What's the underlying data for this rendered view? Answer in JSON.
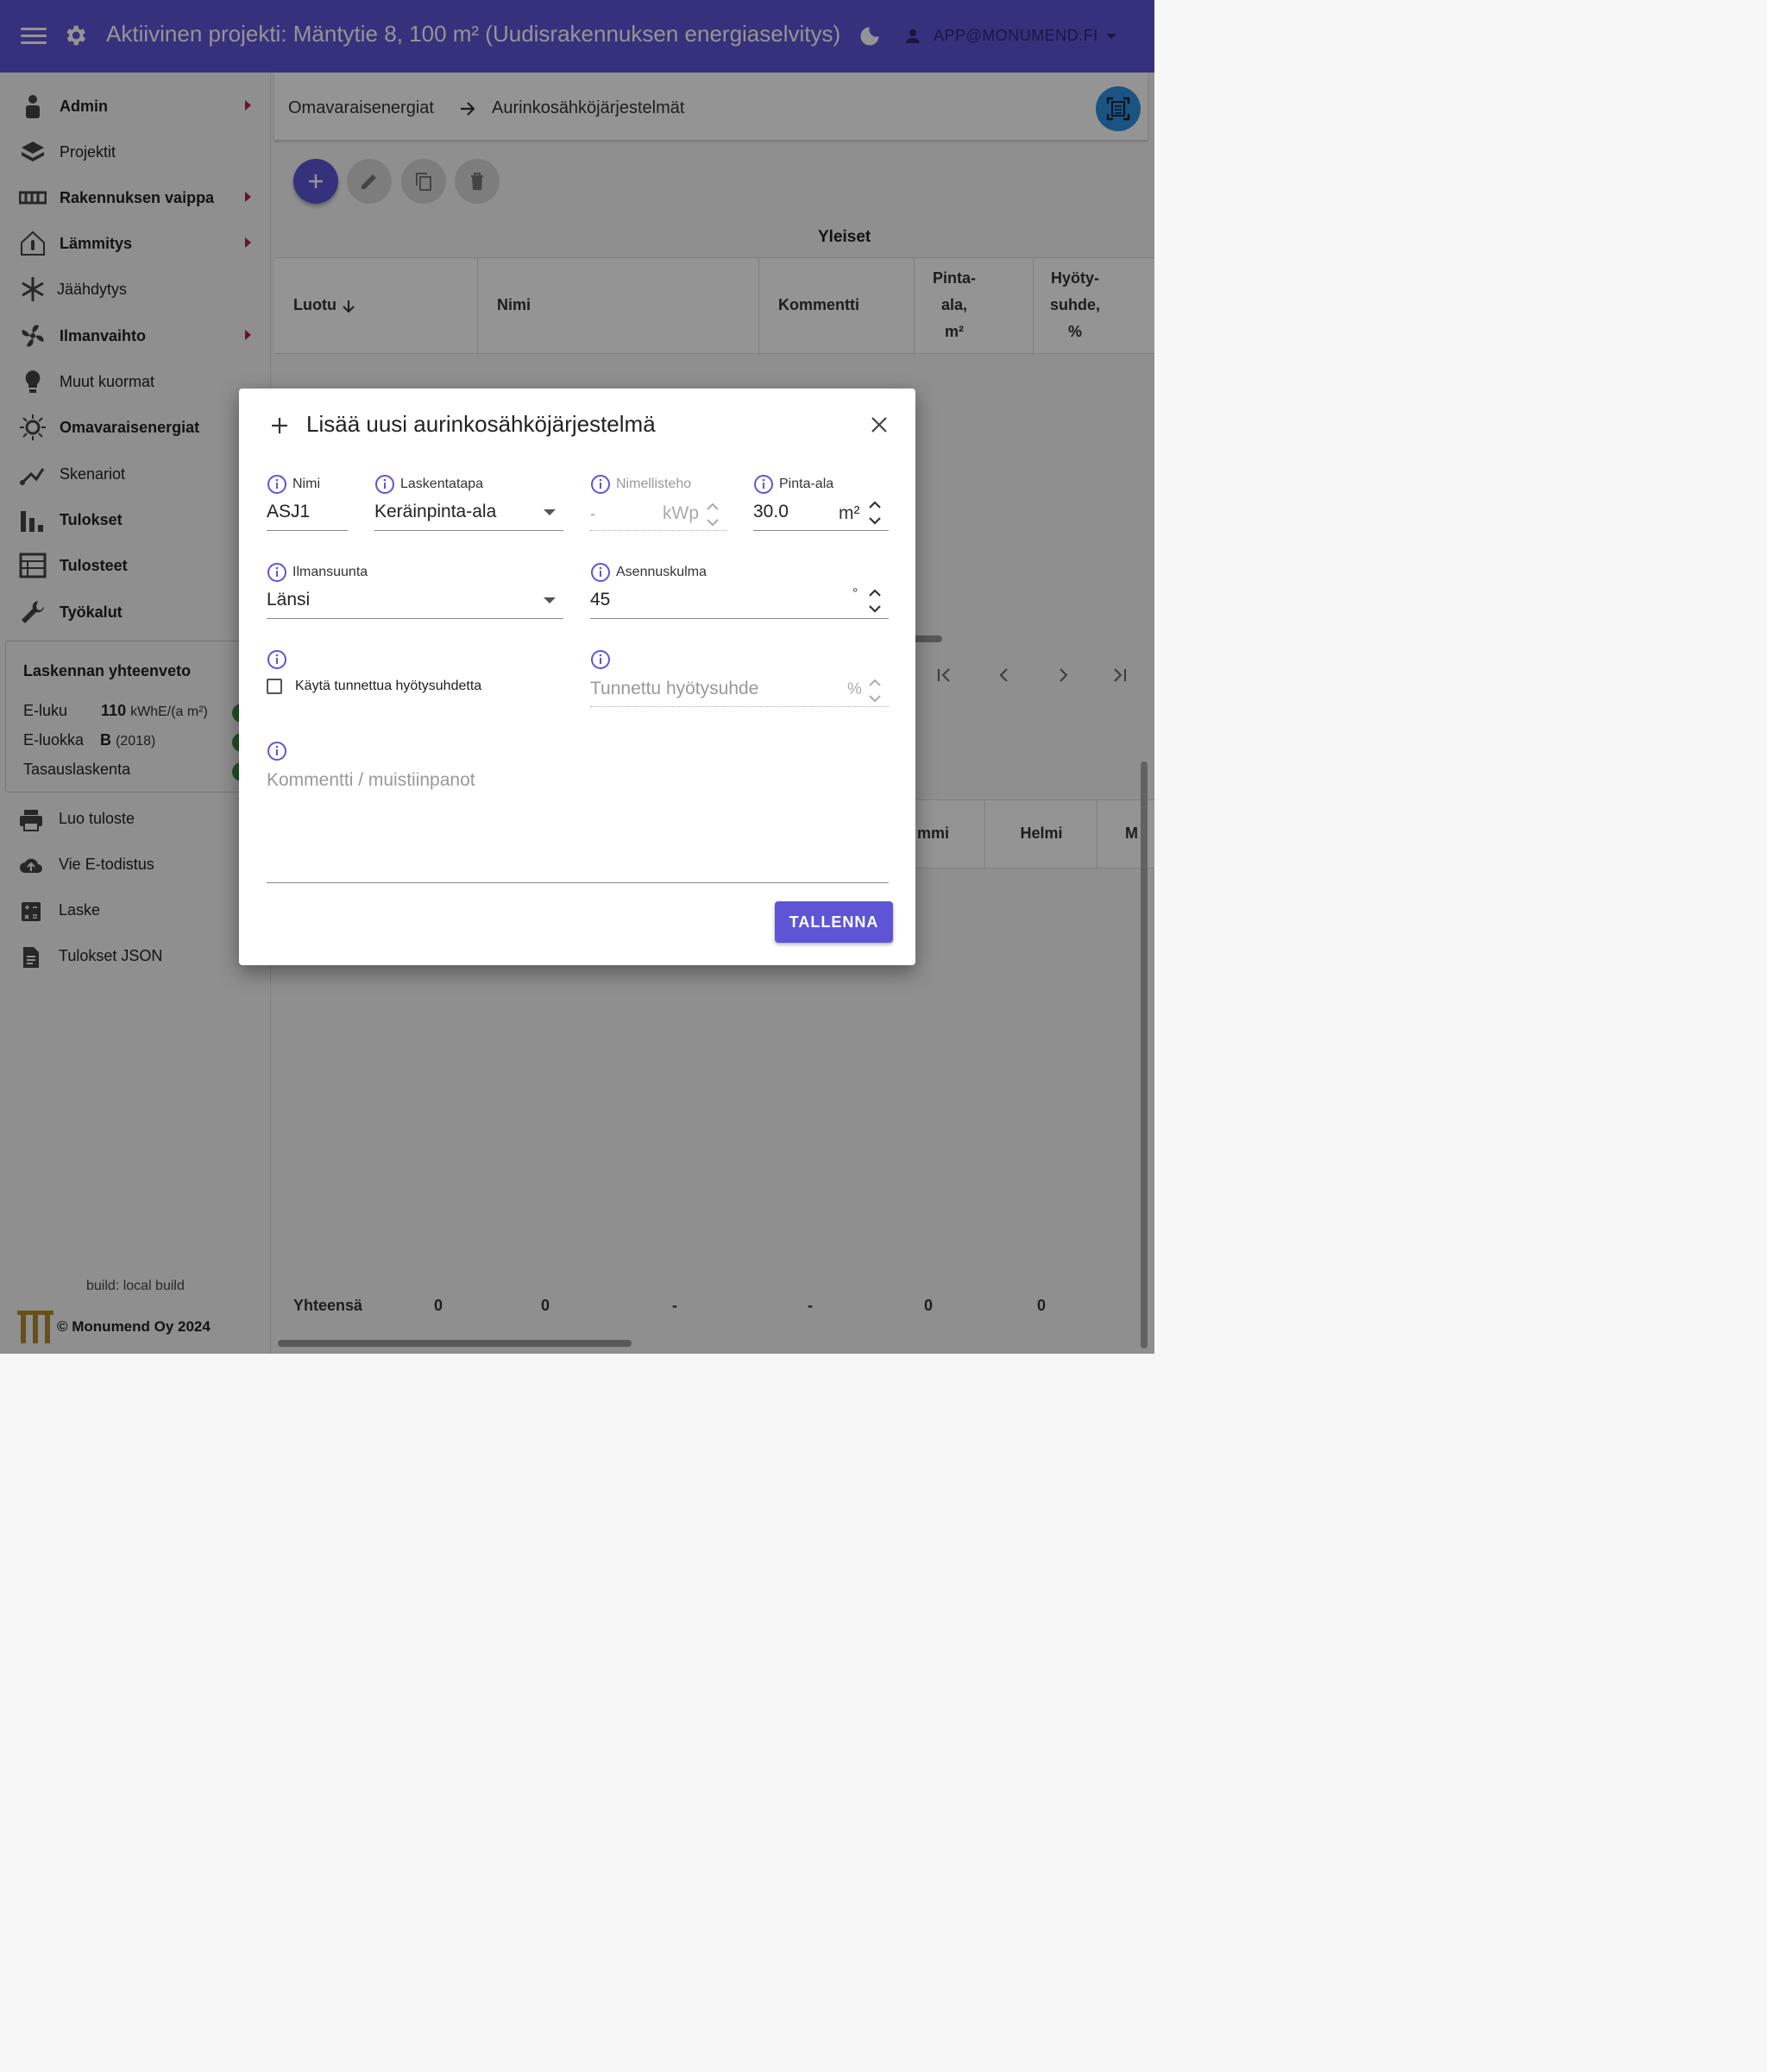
{
  "app": {
    "title": "Aktiivinen projekti: Mäntytie 8, 100 m² (Uudisrakennuksen energiaselvitys)",
    "user_email": "APP@MONUMEND.FI",
    "accent_color": "#5e55d6"
  },
  "sidebar": {
    "items": [
      {
        "label": "Admin",
        "icon": "admin-user-icon",
        "submenu": true
      },
      {
        "label": "Projektit",
        "icon": "layers-icon",
        "submenu": false
      },
      {
        "label": "Rakennuksen vaippa",
        "icon": "wall-icon",
        "submenu": true
      },
      {
        "label": "Lämmitys",
        "icon": "house-thermometer-icon",
        "submenu": true
      },
      {
        "label": "Jäähdytys",
        "icon": "snowflake-icon",
        "submenu": false
      },
      {
        "label": "Ilmanvaihto",
        "icon": "fan-icon",
        "submenu": true
      },
      {
        "label": "Muut kuormat",
        "icon": "lightbulb-icon",
        "submenu": false
      },
      {
        "label": "Omavaraisenergiat",
        "icon": "sun-icon",
        "submenu": false
      },
      {
        "label": "Skenariot",
        "icon": "branch-icon",
        "submenu": false
      },
      {
        "label": "Tulokset",
        "icon": "bar-chart-icon",
        "submenu": false
      },
      {
        "label": "Tulosteet",
        "icon": "report-icon",
        "submenu": false
      },
      {
        "label": "Työkalut",
        "icon": "wrench-icon",
        "submenu": false
      }
    ],
    "summary": {
      "title": "Laskennan yhteenveto",
      "eluku_label": "E-luku",
      "eluku_value": "110",
      "eluku_unit": "kWhE/(a m²)",
      "eluokka_label": "E-luokka",
      "eluokka_value": "B",
      "eluokka_year": "(2018)",
      "tasaus_label": "Tasauslaskenta"
    },
    "actions": [
      {
        "label": "Luo tuloste",
        "icon": "printer-icon"
      },
      {
        "label": "Vie E-todistus",
        "icon": "cloud-upload-icon"
      },
      {
        "label": "Laske",
        "icon": "calculator-icon"
      },
      {
        "label": "Tulokset JSON",
        "icon": "document-icon"
      }
    ],
    "build": "build: local build",
    "copyright": "© Monumend Oy 2024"
  },
  "main": {
    "breadcrumb": [
      "Omavaraisenergiat",
      "Aurinkosähköjärjestelmät"
    ],
    "group_header": "Yleiset",
    "columns": {
      "created": "Luotu",
      "name": "Nimi",
      "comment": "Kommentti",
      "area_l1": "Pinta-",
      "area_l2": "ala,",
      "area_l3": "m²",
      "eff_l1": "Hyöty-",
      "eff_l2": "suhde,",
      "eff_l3": "%"
    },
    "month_columns": [
      "mmi",
      "Helmi",
      "M"
    ],
    "totals": {
      "label": "Yhteensä",
      "values": [
        "0",
        "0",
        "-",
        "-",
        "0",
        "0"
      ]
    }
  },
  "dialog": {
    "title": "Lisää uusi aurinkosähköjärjestelmä",
    "fields": {
      "name": {
        "label": "Nimi",
        "value": "ASJ1"
      },
      "method": {
        "label": "Laskentatapa",
        "value": "Keräinpinta-ala"
      },
      "nominal_power": {
        "label": "Nimellisteho",
        "value": "-",
        "unit": "kWp"
      },
      "area": {
        "label": "Pinta-ala",
        "value": "30.0",
        "unit": "m²"
      },
      "orientation": {
        "label": "Ilmansuunta",
        "value": "Länsi"
      },
      "tilt": {
        "label": "Asennuskulma",
        "value": "45",
        "unit": "°"
      },
      "use_known_eff": {
        "label": "Käytä tunnettua hyötysuhdetta",
        "checked": false
      },
      "known_eff": {
        "placeholder": "Tunnettu hyötysuhde",
        "unit": "%"
      },
      "comment": {
        "placeholder": "Kommentti / muistiinpanot"
      }
    },
    "save_label": "TALLENNA"
  }
}
